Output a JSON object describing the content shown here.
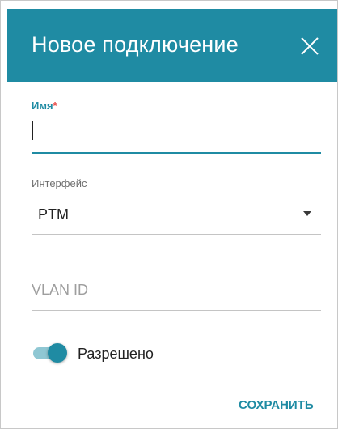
{
  "dialog": {
    "title": "Новое подключение",
    "close_icon": "close-icon",
    "save_label": "СОХРАНИТЬ"
  },
  "form": {
    "name": {
      "label": "Имя",
      "required_mark": "*",
      "value": ""
    },
    "interface": {
      "label": "Интерфейс",
      "selected": "PTM",
      "dropdown_icon": "caret-down-icon"
    },
    "vlan_id": {
      "placeholder": "VLAN ID",
      "value": ""
    },
    "enabled": {
      "label": "Разрешено",
      "on": true
    }
  },
  "colors": {
    "accent": "#1f8ba3",
    "header_bg": "#1f8ba3",
    "required": "#e53935",
    "toggle_track": "#8fc7d3"
  }
}
